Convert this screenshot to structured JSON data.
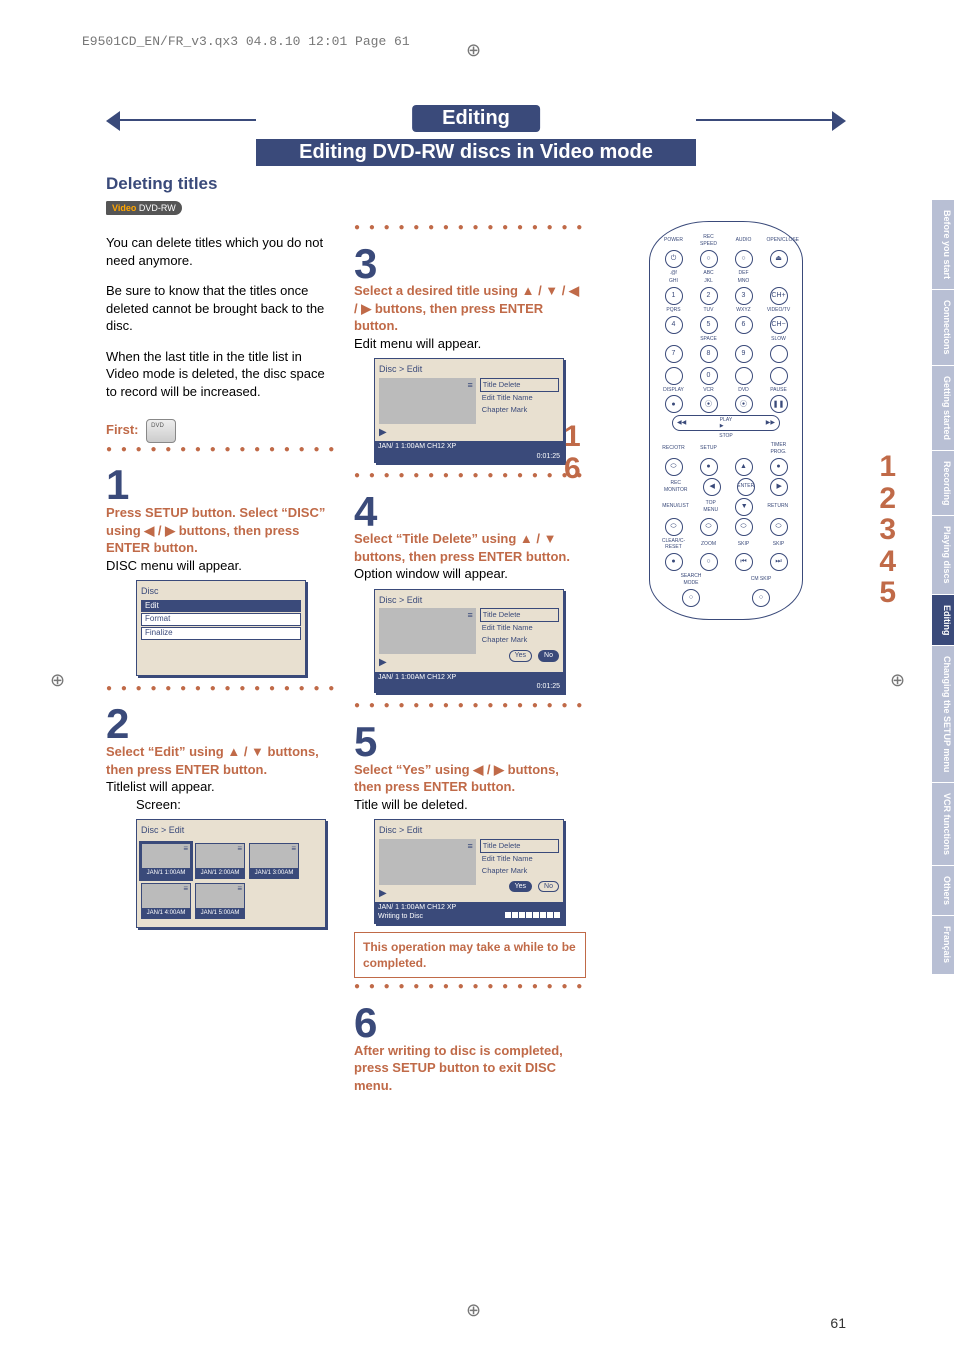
{
  "meta": {
    "header": "E9501CD_EN/FR_v3.qx3  04.8.10  12:01  Page 61"
  },
  "page_number": "61",
  "banner": {
    "title": "Editing",
    "subtitle": "Editing DVD-RW discs in Video mode"
  },
  "section": {
    "title": "Deleting titles",
    "badge_prefix": "Video",
    "badge": "DVD-RW"
  },
  "intro": {
    "p1": "You can delete titles which you do not need anymore.",
    "p2": "Be sure to know that the titles once deleted cannot be brought back to the disc.",
    "p3": "When the last title in the title list in Video mode is deleted, the disc space to record will be increased.",
    "first": "First:"
  },
  "steps": {
    "s1": {
      "num": "1",
      "instr": "Press SETUP button. Select “DISC” using ◀ / ▶ buttons, then press ENTER button.",
      "body": "DISC menu will appear."
    },
    "s2": {
      "num": "2",
      "instr": "Select “Edit” using ▲ / ▼ buttons, then press ENTER button.",
      "body": "Titlelist will appear.",
      "screen_label": "Screen:"
    },
    "s3": {
      "num": "3",
      "instr": "Select a desired title using ▲ / ▼ / ◀ / ▶ buttons, then press ENTER button.",
      "body": "Edit menu will appear."
    },
    "s4": {
      "num": "4",
      "instr": "Select “Title Delete” using ▲ / ▼ buttons, then press ENTER button.",
      "body": "Option window will appear."
    },
    "s5": {
      "num": "5",
      "instr": "Select “Yes” using ◀ / ▶ buttons, then press ENTER button.",
      "body": "Title will be deleted."
    },
    "s6": {
      "num": "6",
      "instr": "After writing to disc is completed, press SETUP button to exit DISC menu."
    }
  },
  "callout": "This operation may take a while to be completed.",
  "screens": {
    "disc_menu": {
      "title": "Disc",
      "items": [
        "Edit",
        "Format",
        "Finalize"
      ],
      "selected": 0
    },
    "titlelist": {
      "title": "Disc > Edit",
      "thumbs": [
        "JAN/1  1:00AM",
        "JAN/1  2:00AM",
        "JAN/1  3:00AM",
        "JAN/1  4:00AM",
        "JAN/1  5:00AM"
      ]
    },
    "edit_menu": {
      "title": "Disc > Edit",
      "options": [
        "Title Delete",
        "Edit Title Name",
        "Chapter Mark"
      ],
      "selected": 0,
      "status_left": "JAN/ 1  1:00AM  CH12    XP",
      "status_right": "0:01:25"
    },
    "confirm": {
      "title": "Disc > Edit",
      "options": [
        "Title Delete",
        "Edit Title Name",
        "Chapter Mark"
      ],
      "yes": "Yes",
      "no": "No",
      "status_left": "JAN/ 1  1:00AM  CH12    XP",
      "status_right": "0:01:25"
    },
    "writing": {
      "title": "Disc > Edit",
      "options": [
        "Title Delete",
        "Edit Title Name",
        "Chapter Mark"
      ],
      "yes": "Yes",
      "no": "No",
      "status_left": "JAN/ 1  1:00AM  CH12    XP",
      "writing": "Writing to Disc"
    }
  },
  "remote": {
    "row_labels1": [
      "POWER",
      "REC SPEED",
      "AUDIO",
      "OPEN/CLOSE"
    ],
    "row_labels2": [
      ".@!",
      "ABC",
      "DEF",
      ""
    ],
    "rows": [
      [
        "1",
        "2",
        "3",
        "CH+"
      ],
      [
        "4",
        "5",
        "6",
        "CH−"
      ],
      [
        "7",
        "8",
        "9",
        ""
      ],
      [
        "",
        "0",
        "",
        ""
      ]
    ],
    "mid_labels": [
      "GHI",
      "JKL",
      "MNO",
      "PQRS",
      "TUV",
      "WXYZ",
      "VIDEO/TV",
      "SPACE",
      "SLOW",
      "DISPLAY",
      "VCR",
      "DVD",
      "PAUSE"
    ],
    "transport": {
      "left": "◀◀",
      "center": "PLAY",
      "right": "▶▶",
      "stop": "STOP"
    },
    "nav_row": [
      "REC/OTR",
      "SETUP",
      "",
      "TIMER PROG."
    ],
    "nav_center": "ENTER",
    "bottom_rows": [
      "REC MONITOR",
      "MENU/LIST",
      "TOP MENU",
      "RETURN",
      "CLEAR/C-RESET",
      "ZOOM",
      "SKIP",
      "SKIP",
      "SEARCH MODE",
      "CM SKIP"
    ]
  },
  "side_steps_left": [
    "1",
    "6"
  ],
  "side_steps_right": [
    "1",
    "2",
    "3",
    "4",
    "5"
  ],
  "tabs": [
    "Before you start",
    "Connections",
    "Getting started",
    "Recording",
    "Playing discs",
    "Editing",
    "Changing the SETUP menu",
    "VCR functions",
    "Others",
    "Français"
  ],
  "tab_active": 5
}
